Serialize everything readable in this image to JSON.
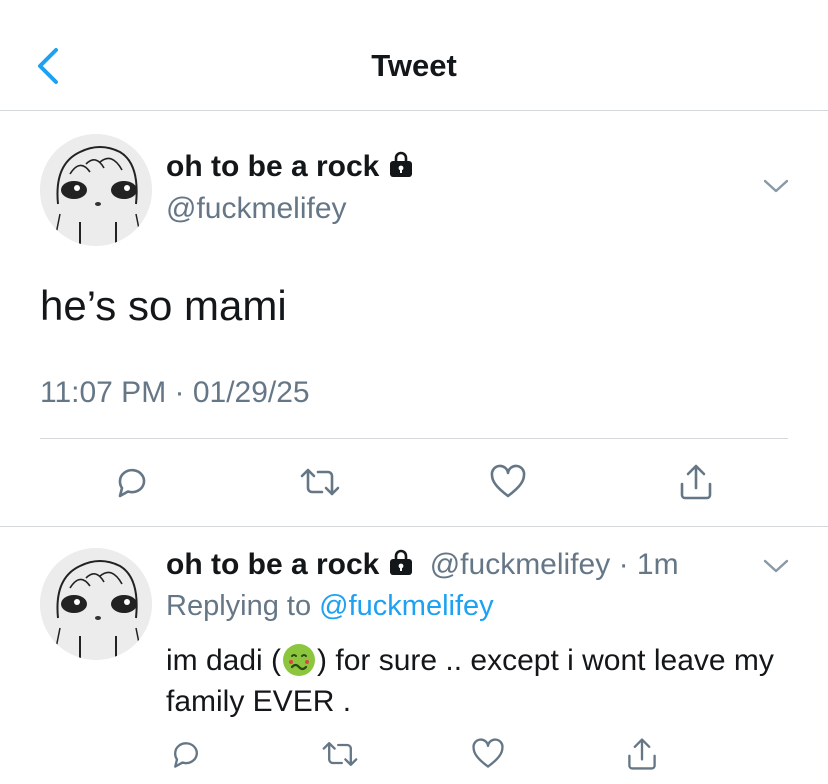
{
  "header": {
    "title": "Tweet"
  },
  "tweet": {
    "name": "oh to be a rock",
    "handle": "@fuckmelifey",
    "text": "he’s so mami",
    "timestamp": "11:07 PM · 01/29/25"
  },
  "reply": {
    "name": "oh to be a rock",
    "handle": "@fuckmelifey",
    "time": "· 1m",
    "replying_prefix": "Replying to",
    "replying_handle": "@fuckmelifey",
    "text_before": "im dadi (",
    "emoji": "nauseated-face",
    "text_after": ") for sure .. except i wont leave my family EVER ."
  },
  "colors": {
    "accent": "#1da1f2",
    "muted": "#657786",
    "divider": "#d6d9dc"
  }
}
